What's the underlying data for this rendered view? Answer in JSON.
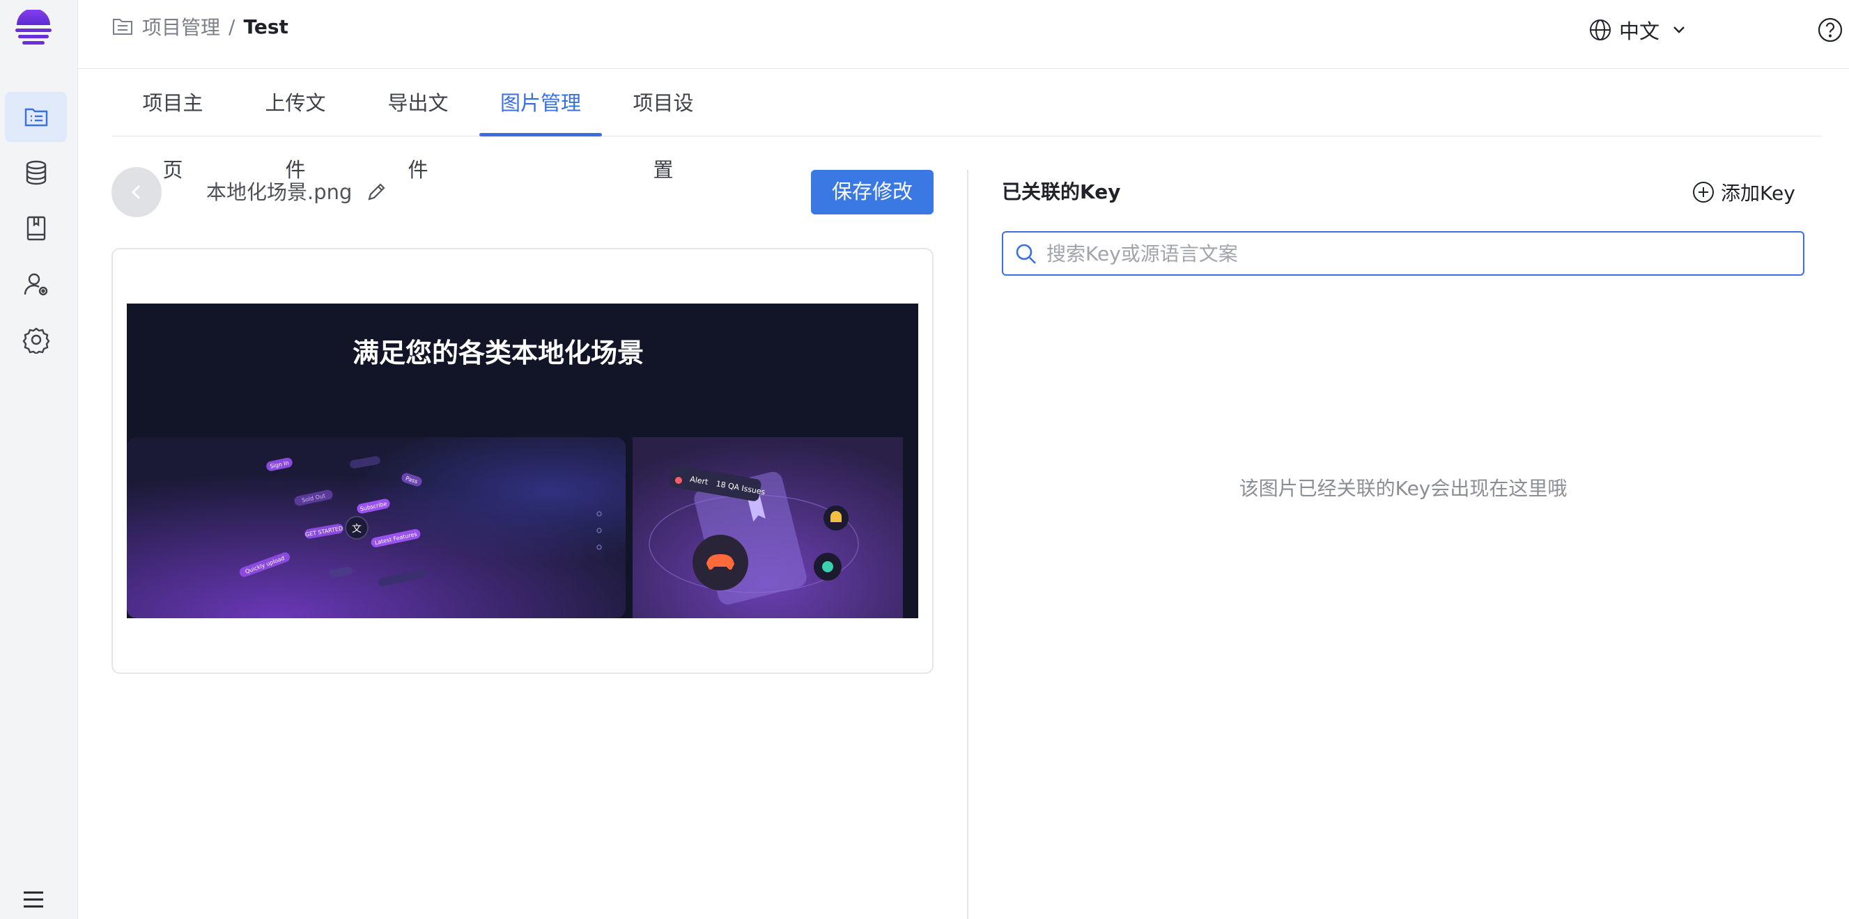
{
  "breadcrumb": {
    "parent": "项目管理",
    "separator": "/",
    "current": "Test"
  },
  "header": {
    "language": "中文"
  },
  "tabs": [
    {
      "label": "项目主页"
    },
    {
      "label": "上传文件"
    },
    {
      "label": "导出文件"
    },
    {
      "label": "图片管理",
      "active": true
    },
    {
      "label": "项目设置"
    }
  ],
  "sidebar": {
    "items": [
      {
        "icon": "project-list-icon",
        "active": true
      },
      {
        "icon": "database-icon"
      },
      {
        "icon": "book-icon"
      },
      {
        "icon": "user-settings-icon"
      },
      {
        "icon": "gear-icon"
      }
    ],
    "bottom_icon": "menu-icon"
  },
  "editor": {
    "filename": "本地化场景.png",
    "save_label": "保存修改",
    "image": {
      "headline": "满足您的各类本地化场景",
      "left_tags": [
        "Sign In",
        "Subscribe",
        "GET STARTED",
        "Latest Features",
        "Quickly upload",
        "Sold Out",
        "Pass"
      ],
      "alert_label": "Alert",
      "alert_detail": "18 QA Issues"
    }
  },
  "keys_panel": {
    "title": "已关联的Key",
    "add_label": "添加Key",
    "search_placeholder": "搜索Key或源语言文案",
    "empty_text": "该图片已经关联的Key会出现在这里哦"
  },
  "colors": {
    "accent": "#3a6fe0",
    "primary_button": "#3a78e4",
    "sidebar_bg": "#f3f4f6",
    "logo": "#6a2fd8"
  }
}
